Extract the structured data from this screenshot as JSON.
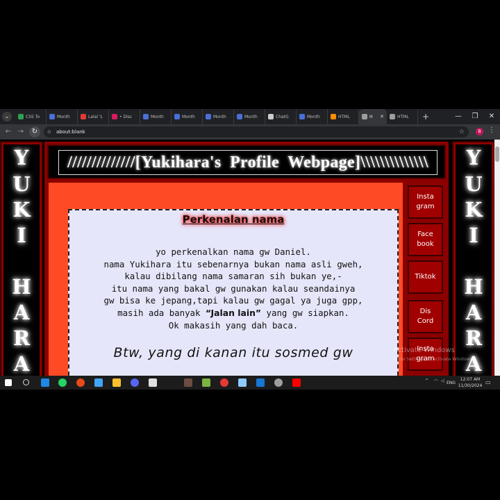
{
  "browser": {
    "tabs": [
      {
        "label": "CSS To",
        "color": "#2e9e4f",
        "active": false
      },
      {
        "label": "Month",
        "color": "#4a6fd8",
        "active": false
      },
      {
        "label": "Lalal 'L",
        "color": "#e53935",
        "active": false
      },
      {
        "label": "• Disc",
        "color": "#d81b60",
        "active": false
      },
      {
        "label": "Month",
        "color": "#4a6fd8",
        "active": false
      },
      {
        "label": "Month",
        "color": "#4a6fd8",
        "active": false
      },
      {
        "label": "Month",
        "color": "#4a6fd8",
        "active": false
      },
      {
        "label": "Month",
        "color": "#4a6fd8",
        "active": false
      },
      {
        "label": "ChatG",
        "color": "#cccccc",
        "active": false
      },
      {
        "label": "Month",
        "color": "#4a6fd8",
        "active": false
      },
      {
        "label": "HTML",
        "color": "#ff8c00",
        "active": false
      },
      {
        "label": "H",
        "color": "#9e9e9e",
        "active": true
      },
      {
        "label": "HTML",
        "color": "#9e9e9e",
        "active": false
      }
    ],
    "new_tab": "+",
    "url": "about:blank",
    "profile_initial": "B"
  },
  "page": {
    "side_letters": [
      "Y",
      "U",
      "K",
      "I",
      "",
      "H",
      "A",
      "R",
      "A"
    ],
    "header_title": "//////////////[Yukihara's  Profile  Webpage]\\\\\\\\\\\\\\\\\\\\\\\\\\\\",
    "card": {
      "title": "Perkenalan nama",
      "lines": [
        "yo perkenalkan nama gw Daniel.",
        "nama Yukihara itu sebenarnya bukan nama asli gweh,",
        "kalau dibilang nama samaran sih bukan ye,-",
        "itu nama yang bakal gw gunakan kalau seandainya",
        "gw bisa ke jepang,tapi kalau gw gagal ya juga gpp,"
      ],
      "line6_pre": "masih ada banyak ",
      "line6_bold": "“Jalan lain”",
      "line6_post": " yang gw siapkan.",
      "line7": "Ok makasih yang dah baca.",
      "footer": "Btw, yang di kanan itu sosmed gw"
    },
    "social_buttons": [
      "Insta\ngram",
      "Face\nbook",
      "Tiktok",
      "Dis\nCord",
      "Insta\ngram"
    ],
    "watermark": {
      "line1": "Activate Windows",
      "line2": "Go to Settings to activate Windows."
    }
  },
  "taskbar": {
    "lang": "ENG",
    "time": "12:07 AM",
    "date": "11/30/2024"
  },
  "colors": {
    "accent_red": "#8b0000",
    "content_bg": "#ff4a26",
    "card_bg": "#e6e6fa"
  }
}
